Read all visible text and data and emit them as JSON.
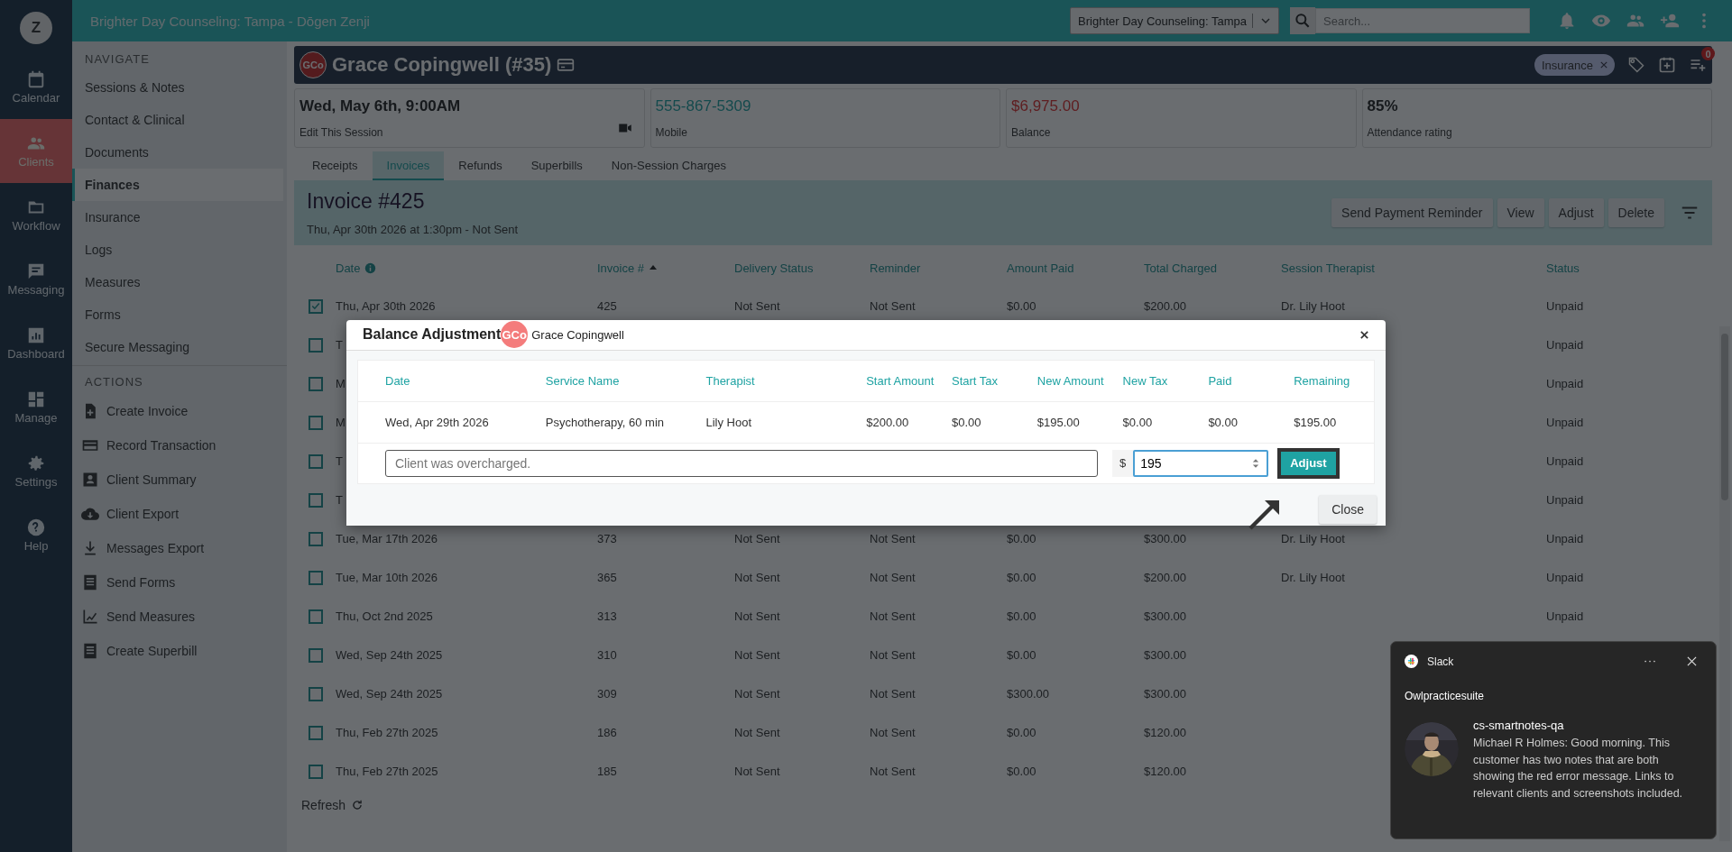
{
  "rail": {
    "logo": "Z",
    "items": [
      {
        "label": "Calendar",
        "selected": false
      },
      {
        "label": "Clients",
        "selected": true
      },
      {
        "label": "Workflow",
        "selected": false
      },
      {
        "label": "Messaging",
        "selected": false
      },
      {
        "label": "Dashboard",
        "selected": false
      },
      {
        "label": "Manage",
        "selected": false
      },
      {
        "label": "Settings",
        "selected": false
      },
      {
        "label": "Help",
        "selected": false
      }
    ]
  },
  "top_bar": {
    "title": "Brighter Day Counseling: Tampa - Dōgen Zenji",
    "location_select": "Brighter Day Counseling: Tampa",
    "search": {
      "placeholder": "Search..."
    }
  },
  "nav": {
    "heading": "NAVIGATE",
    "items": [
      {
        "label": "Sessions & Notes",
        "selected": false
      },
      {
        "label": "Contact & Clinical",
        "selected": false
      },
      {
        "label": "Documents",
        "selected": false
      },
      {
        "label": "Finances",
        "selected": true
      },
      {
        "label": "Insurance",
        "selected": false
      },
      {
        "label": "Logs",
        "selected": false
      },
      {
        "label": "Measures",
        "selected": false
      },
      {
        "label": "Forms",
        "selected": false
      },
      {
        "label": "Secure Messaging",
        "selected": false
      }
    ],
    "actions_heading": "ACTIONS",
    "actions": [
      "Create Invoice",
      "Record Transaction",
      "Client Summary",
      "Client Export",
      "Messages Export",
      "Send Forms",
      "Send Measures",
      "Create Superbill"
    ]
  },
  "client": {
    "initials": "GCo",
    "name": "Grace Copingwell (#35)",
    "tag": "Insurance",
    "badge": "0"
  },
  "cards": [
    {
      "value": "Wed, May 6th, 9:00AM",
      "label": "Edit This Session",
      "kind": "session"
    },
    {
      "value": "555-867-5309",
      "label": "Mobile",
      "kind": "link"
    },
    {
      "value": "$6,975.00",
      "label": "Balance",
      "kind": "negative"
    },
    {
      "value": "85%",
      "label": "Attendance rating",
      "kind": "plain"
    }
  ],
  "tabs": [
    {
      "label": "Receipts",
      "selected": false
    },
    {
      "label": "Invoices",
      "selected": true
    },
    {
      "label": "Refunds",
      "selected": false
    },
    {
      "label": "Superbills",
      "selected": false
    },
    {
      "label": "Non-Session Charges",
      "selected": false
    }
  ],
  "invoice": {
    "title": "Invoice #425",
    "subtitle": "Thu, Apr 30th 2026 at 1:30pm - Not Sent",
    "buttons": [
      "Send Payment Reminder",
      "View",
      "Adjust",
      "Delete"
    ]
  },
  "table": {
    "columns": [
      "Date",
      "Invoice #",
      "Delivery Status",
      "Reminder",
      "Amount Paid",
      "Total Charged",
      "Session Therapist",
      "Status"
    ],
    "rows": [
      {
        "checked": true,
        "date": "Thu, Apr 30th 2026",
        "invoice": "425",
        "delivery": "Not Sent",
        "reminder": "Not Sent",
        "paid": "$0.00",
        "total": "$200.00",
        "therapist": "Dr. Lily Hoot",
        "status": "Unpaid"
      },
      {
        "checked": false,
        "date": "T",
        "status": "Unpaid"
      },
      {
        "checked": false,
        "date": "M",
        "status": "Unpaid"
      },
      {
        "checked": false,
        "date": "M",
        "status": "Unpaid"
      },
      {
        "checked": false,
        "date": "T",
        "status": "Unpaid"
      },
      {
        "checked": false,
        "date": "T",
        "status": "Unpaid"
      },
      {
        "checked": false,
        "date": "Tue, Mar 17th 2026",
        "invoice": "373",
        "delivery": "Not Sent",
        "reminder": "Not Sent",
        "paid": "$0.00",
        "total": "$300.00",
        "therapist": "Dr. Lily Hoot",
        "status": "Unpaid"
      },
      {
        "checked": false,
        "date": "Tue, Mar 10th 2026",
        "invoice": "365",
        "delivery": "Not Sent",
        "reminder": "Not Sent",
        "paid": "$0.00",
        "total": "$200.00",
        "therapist": "Dr. Lily Hoot",
        "status": "Unpaid"
      },
      {
        "checked": false,
        "date": "Thu, Oct 2nd 2025",
        "invoice": "313",
        "delivery": "Not Sent",
        "reminder": "Not Sent",
        "paid": "$0.00",
        "total": "$300.00",
        "status": "Unpaid"
      },
      {
        "checked": false,
        "date": "Wed, Sep 24th 2025",
        "invoice": "310",
        "delivery": "Not Sent",
        "reminder": "Not Sent",
        "paid": "$0.00",
        "total": "$300.00"
      },
      {
        "checked": false,
        "date": "Wed, Sep 24th 2025",
        "invoice": "309",
        "delivery": "Not Sent",
        "reminder": "Not Sent",
        "paid": "$300.00",
        "total": "$300.00"
      },
      {
        "checked": false,
        "date": "Thu, Feb 27th 2025",
        "invoice": "186",
        "delivery": "Not Sent",
        "reminder": "Not Sent",
        "paid": "$0.00",
        "total": "$120.00"
      },
      {
        "checked": false,
        "date": "Thu, Feb 27th 2025",
        "invoice": "185",
        "delivery": "Not Sent",
        "reminder": "Not Sent",
        "paid": "$0.00",
        "total": "$120.00"
      }
    ],
    "refresh": "Refresh"
  },
  "modal": {
    "title": "Balance Adjustment",
    "initials": "GCo",
    "client": "Grace Copingwell",
    "columns": [
      "Date",
      "Service Name",
      "Therapist",
      "Start Amount",
      "Start Tax",
      "New Amount",
      "New Tax",
      "Paid",
      "Remaining"
    ],
    "row": [
      "Wed, Apr 29th 2026",
      "Psychotherapy, 60 min",
      "Lily Hoot",
      "$200.00",
      "$0.00",
      "$195.00",
      "$0.00",
      "$0.00",
      "$195.00"
    ],
    "reason": {
      "placeholder": "Client was overcharged."
    },
    "currency": "$",
    "amount": "195",
    "adjust_button": "Adjust",
    "close_button": "Close"
  },
  "notification": {
    "app": "Slack",
    "workspace": "Owlpracticesuite",
    "channel": "cs-smartnotes-qa",
    "message": "Michael R Holmes: Good morning. This customer has two notes that are both showing the red error message. Links to relevant clients and screenshots included."
  }
}
